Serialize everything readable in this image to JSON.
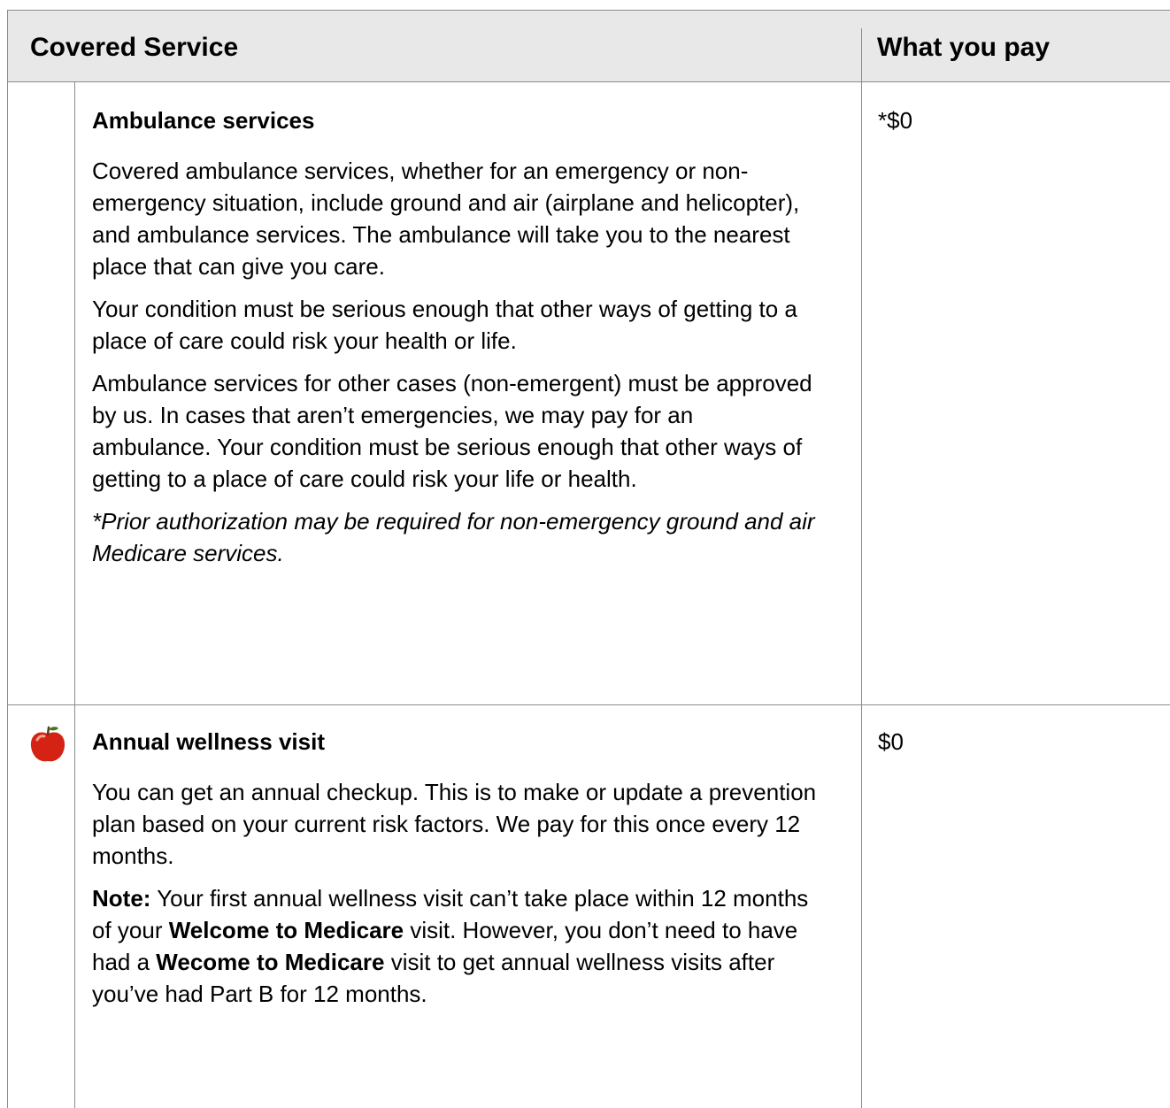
{
  "header": {
    "covered_service": "Covered Service",
    "what_you_pay": "What you pay"
  },
  "rows": [
    {
      "title": "Ambulance services",
      "paragraphs": [
        "Covered ambulance services, whether for an emergency or non-emergency situation, include ground and air (airplane and helicopter), and ambulance services. The ambulance will take you to the nearest place that can give you care.",
        "Your condition must be serious enough that other ways of getting to a place of care could risk your health or life.",
        "Ambulance services for other cases (non-emergent) must be approved by us. In cases that aren’t emergencies, we may pay for an ambulance. Your condition must be serious enough that other ways of getting to a place of care could risk your life or health."
      ],
      "note_italic": "*Prior authorization may be required for non-emergency ground and air Medicare services.",
      "pay": "*$0"
    },
    {
      "icon": "apple-icon",
      "title": "Annual wellness visit",
      "paragraphs": [
        "You can get an annual checkup. This is to make or update a prevention plan based on your current risk factors. We pay for this once every 12 months."
      ],
      "note": {
        "label": "Note:",
        "text1": " Your first annual wellness visit can’t take place within 12 months of your ",
        "bold1": "Welcome to Medicare",
        "text2": " visit. However, you don’t need to have had a ",
        "bold2": "Wecome to Medicare",
        "text3": " visit to get annual wellness visits after you’ve had Part B for 12 months."
      },
      "pay": "$0"
    }
  ]
}
